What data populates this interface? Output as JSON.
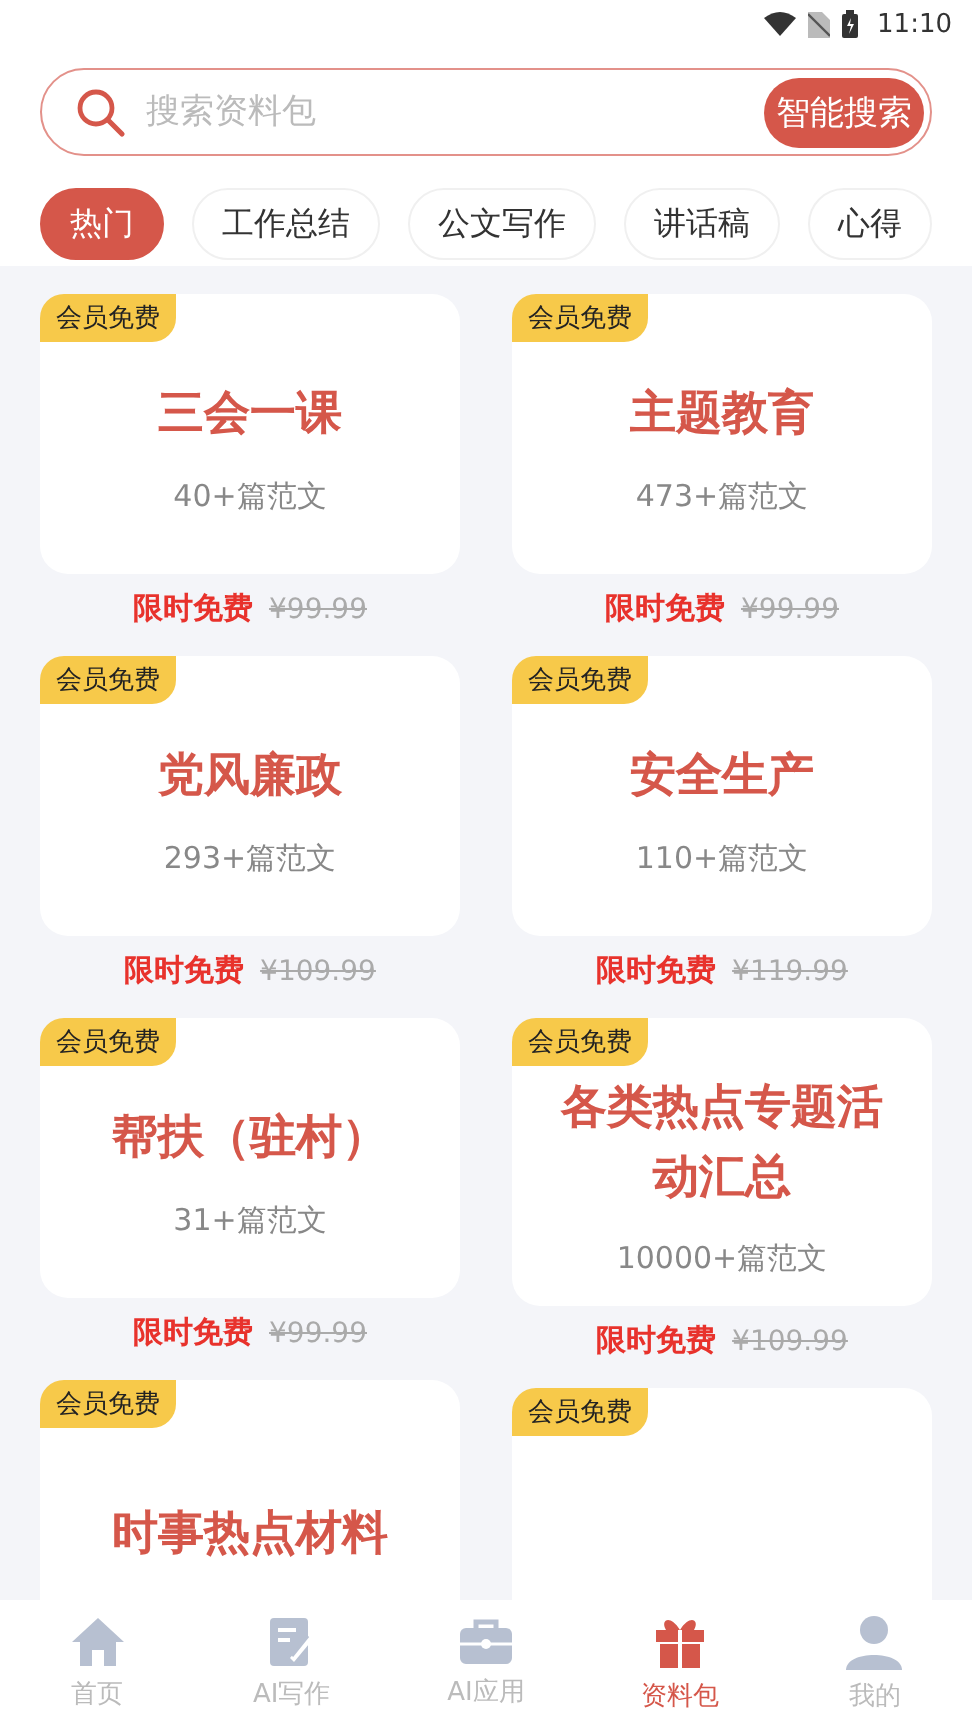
{
  "status_bar": {
    "time": "11:10"
  },
  "search": {
    "placeholder": "搜索资料包",
    "button": "智能搜索"
  },
  "tabs": [
    {
      "label": "热门",
      "selected": true
    },
    {
      "label": "工作总结",
      "selected": false
    },
    {
      "label": "公文写作",
      "selected": false
    },
    {
      "label": "讲话稿",
      "selected": false
    },
    {
      "label": "心得",
      "selected": false
    }
  ],
  "columns": [
    {
      "cards": [
        {
          "tag": "会员免费",
          "title": "三会一课",
          "count": "40+篇范文",
          "price_label": "限时免费",
          "original_price": "¥99.99"
        },
        {
          "tag": "会员免费",
          "title": "党风廉政",
          "count": "293+篇范文",
          "price_label": "限时免费",
          "original_price": "¥109.99"
        },
        {
          "tag": "会员免费",
          "title": "帮扶（驻村）",
          "count": "31+篇范文",
          "price_label": "限时免费",
          "original_price": "¥99.99"
        },
        {
          "tag": "会员免费",
          "title": "时事热点材料"
        }
      ]
    },
    {
      "cards": [
        {
          "tag": "会员免费",
          "title": "主题教育",
          "count": "473+篇范文",
          "price_label": "限时免费",
          "original_price": "¥99.99"
        },
        {
          "tag": "会员免费",
          "title": "安全生产",
          "count": "110+篇范文",
          "price_label": "限时免费",
          "original_price": "¥119.99"
        },
        {
          "tag": "会员免费",
          "title": "各类热点专题活动汇总",
          "count": "10000+篇范文",
          "price_label": "限时免费",
          "original_price": "¥109.99"
        },
        {
          "tag": "会员免费"
        }
      ]
    }
  ],
  "nav": [
    {
      "label": "首页",
      "kind": "home",
      "selected": false
    },
    {
      "label": "AI写作",
      "kind": "write",
      "selected": false
    },
    {
      "label": "AI应用",
      "kind": "toolbox",
      "selected": false
    },
    {
      "label": "资料包",
      "kind": "gift",
      "selected": true
    },
    {
      "label": "我的",
      "kind": "person",
      "selected": false
    }
  ]
}
